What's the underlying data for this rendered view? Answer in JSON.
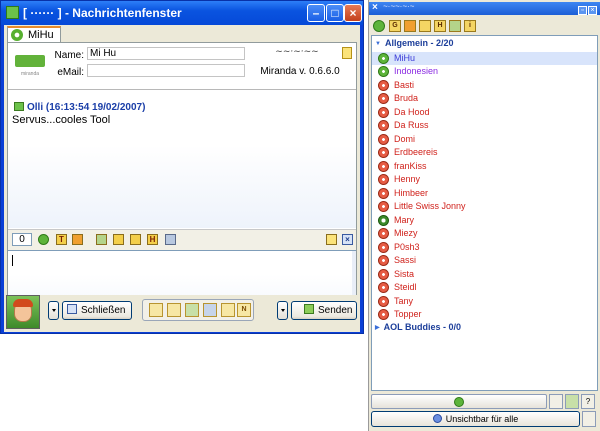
{
  "message_window": {
    "title": "[ ······ ] - Nachrichtenfenster",
    "tab_label": "MiHu",
    "name_label": "Name:",
    "name_value": "Mi Hu",
    "email_label": "eMail:",
    "email_value": "",
    "version": "Miranda v. 0.6.6.0",
    "message_sender": "Olli (16:13:54 19/02/2007)",
    "message_text": "Servus...cooles Tool",
    "char_counter": "0",
    "close_label": "Schließen",
    "send_label": "Senden"
  },
  "contact_list": {
    "groups": [
      {
        "label": "Allgemein - 2/20",
        "contacts": [
          {
            "name": "MiHu",
            "status": "online",
            "color": "#3b3bd8"
          },
          {
            "name": "Indonesien",
            "status": "online",
            "color": "#8a2be2"
          },
          {
            "name": "Basti",
            "status": "offline",
            "color": "#d0221c"
          },
          {
            "name": "Bruda",
            "status": "offline",
            "color": "#d0221c"
          },
          {
            "name": "Da Hood",
            "status": "offline",
            "color": "#d0221c"
          },
          {
            "name": "Da Russ",
            "status": "offline",
            "color": "#d0221c"
          },
          {
            "name": "Domi",
            "status": "offline",
            "color": "#d0221c"
          },
          {
            "name": "Erdbeereis",
            "status": "offline",
            "color": "#d0221c"
          },
          {
            "name": "franKiss",
            "status": "offline",
            "color": "#d0221c"
          },
          {
            "name": "Henny",
            "status": "offline",
            "color": "#d0221c"
          },
          {
            "name": "Himbeer",
            "status": "offline",
            "color": "#d0221c"
          },
          {
            "name": "Little Swiss Jonny",
            "status": "offline",
            "color": "#d0221c"
          },
          {
            "name": "Mary",
            "status": "invisible",
            "color": "#d0221c"
          },
          {
            "name": "Miezy",
            "status": "offline",
            "color": "#d0221c"
          },
          {
            "name": "P0sh3",
            "status": "offline",
            "color": "#d0221c"
          },
          {
            "name": "Sassi",
            "status": "offline",
            "color": "#d0221c"
          },
          {
            "name": "Sista",
            "status": "offline",
            "color": "#d0221c"
          },
          {
            "name": "Steidl",
            "status": "offline",
            "color": "#d0221c"
          },
          {
            "name": "Tany",
            "status": "offline",
            "color": "#d0221c"
          },
          {
            "name": "Topper",
            "status": "offline",
            "color": "#d0221c"
          }
        ]
      },
      {
        "label": "AOL Buddies - 0/0",
        "contacts": []
      }
    ],
    "invisible_button_label": "Unsichtbar für alle"
  }
}
